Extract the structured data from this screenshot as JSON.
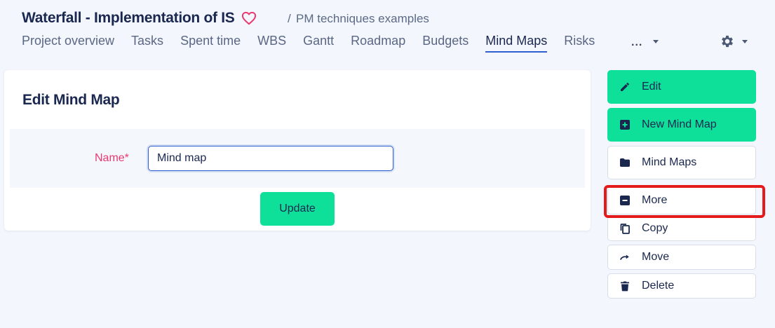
{
  "header": {
    "project_title": "Waterfall - Implementation of IS",
    "breadcrumb_sep": "/",
    "breadcrumb": "PM techniques examples",
    "more_tabs": "..."
  },
  "tabs": [
    {
      "label": "Project overview",
      "active": false
    },
    {
      "label": "Tasks",
      "active": false
    },
    {
      "label": "Spent time",
      "active": false
    },
    {
      "label": "WBS",
      "active": false
    },
    {
      "label": "Gantt",
      "active": false
    },
    {
      "label": "Roadmap",
      "active": false
    },
    {
      "label": "Budgets",
      "active": false
    },
    {
      "label": "Mind Maps",
      "active": true
    },
    {
      "label": "Risks",
      "active": false
    }
  ],
  "form": {
    "title": "Edit Mind Map",
    "name_label": "Name*",
    "name_value": "Mind map",
    "submit_label": "Update"
  },
  "sidebar": {
    "items": [
      {
        "label": "Edit",
        "icon": "pencil-icon"
      },
      {
        "label": "New Mind Map",
        "icon": "plus-square-icon"
      },
      {
        "label": "Mind Maps",
        "icon": "folder-icon"
      },
      {
        "label": "More",
        "icon": "minus-square-icon"
      },
      {
        "label": "Copy",
        "icon": "copy-icon"
      },
      {
        "label": "Move",
        "icon": "redo-arrow-icon"
      },
      {
        "label": "Delete",
        "icon": "trash-icon"
      }
    ]
  },
  "colors": {
    "accent_green": "#0ee09a",
    "active_tab_underline": "#2f5fd0",
    "highlight_red": "#e51a1a",
    "heart_pink": "#e8396e",
    "required_label": "#e8396e"
  }
}
